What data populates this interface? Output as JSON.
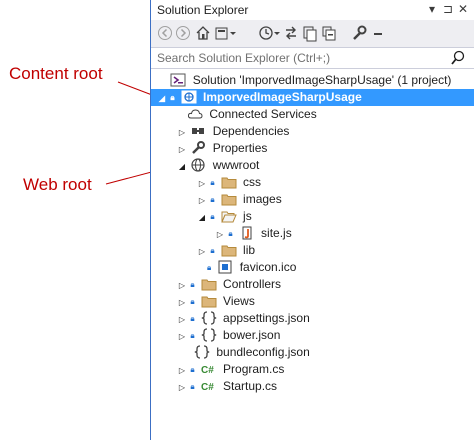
{
  "annotations": {
    "content_root": "Content root",
    "web_root": "Web root"
  },
  "panel": {
    "title": "Solution Explorer",
    "pin_glyph": "⊐",
    "close_glyph": "✕",
    "dropdown_glyph": "▾"
  },
  "toolbar": {
    "back": "◀",
    "forward": "▶",
    "home": "⌂",
    "history": "◔",
    "sync": "⇆",
    "refresh": "↻",
    "collapse": "▣",
    "properties": "🔧",
    "misc": "—"
  },
  "search": {
    "placeholder": "Search Solution Explorer (Ctrl+;)",
    "icon": "⚲"
  },
  "tree": {
    "solution": "Solution 'ImporvedImageSharpUsage' (1 project)",
    "project": "ImporvedImageSharpUsage",
    "connected_services": "Connected Services",
    "dependencies": "Dependencies",
    "properties": "Properties",
    "wwwroot": "wwwroot",
    "css": "css",
    "images": "images",
    "js": "js",
    "site_js": "site.js",
    "lib": "lib",
    "favicon": "favicon.ico",
    "controllers": "Controllers",
    "views": "Views",
    "appsettings": "appsettings.json",
    "bower": "bower.json",
    "bundleconfig": "bundleconfig.json",
    "program": "Program.cs",
    "startup": "Startup.cs"
  }
}
